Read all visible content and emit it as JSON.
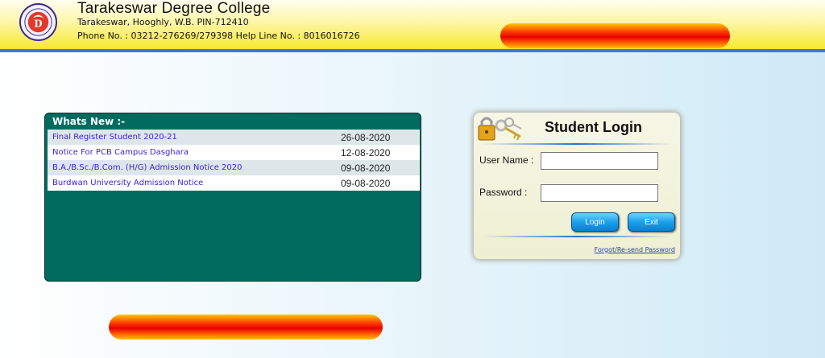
{
  "header": {
    "college_name": "Tarakeswar Degree College",
    "address": "Tarakeswar, Hooghly, W.B. PIN-712410",
    "phone": "Phone No. : 03212-276269/279398   Help Line No. : 8016016726"
  },
  "news": {
    "title": "Whats New :-",
    "items": [
      {
        "text": "Final Register Student 2020-21",
        "date": "26-08-2020"
      },
      {
        "text": "Notice For PCB Campus Dasghara",
        "date": "12-08-2020"
      },
      {
        "text": "B.A./B.Sc./B.Com. (H/G) Admission Notice 2020",
        "date": "09-08-2020"
      },
      {
        "text": "Burdwan University Admission Notice",
        "date": "09-08-2020"
      }
    ]
  },
  "login": {
    "title": "Student Login",
    "user_label": "User Name :",
    "user_value": "",
    "password_label": "Password :",
    "password_value": "",
    "login_button": "Login",
    "exit_button": "Exit",
    "forgot_link": "Forgot/Re-send Password"
  },
  "colors": {
    "header_border": "#2f7fd8",
    "news_panel": "#006b5e",
    "link": "#3a1fd6",
    "button": "#1aa0ea"
  }
}
